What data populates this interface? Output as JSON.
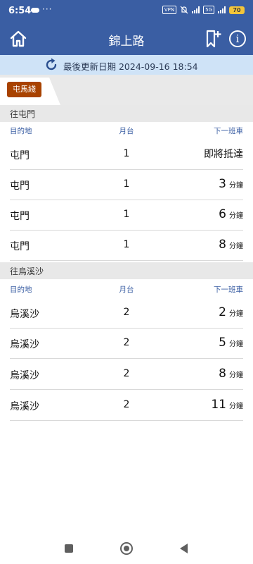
{
  "status_bar": {
    "time": "6:54",
    "overflow": "···",
    "vpn": "VPN",
    "battery": "70",
    "network": "5G"
  },
  "header": {
    "title": "錦上路",
    "home_icon": "home-icon",
    "bookmark_icon": "bookmark-add-icon",
    "info_label": "i"
  },
  "refresh": {
    "text": "最後更新日期 2024-09-16 18:54"
  },
  "tabs": [
    {
      "label": "屯馬綫",
      "color": "#a84200"
    }
  ],
  "columns": {
    "destination": "目的地",
    "platform": "月台",
    "next": "下一班車"
  },
  "sections": [
    {
      "title": "往屯門",
      "rows": [
        {
          "destination": "屯門",
          "platform": "1",
          "next_text": "即將抵達"
        },
        {
          "destination": "屯門",
          "platform": "1",
          "minutes": "3",
          "unit": "分鐘"
        },
        {
          "destination": "屯門",
          "platform": "1",
          "minutes": "6",
          "unit": "分鐘"
        },
        {
          "destination": "屯門",
          "platform": "1",
          "minutes": "8",
          "unit": "分鐘"
        }
      ]
    },
    {
      "title": "往烏溪沙",
      "rows": [
        {
          "destination": "烏溪沙",
          "platform": "2",
          "minutes": "2",
          "unit": "分鐘"
        },
        {
          "destination": "烏溪沙",
          "platform": "2",
          "minutes": "5",
          "unit": "分鐘"
        },
        {
          "destination": "烏溪沙",
          "platform": "2",
          "minutes": "8",
          "unit": "分鐘"
        },
        {
          "destination": "烏溪沙",
          "platform": "2",
          "minutes": "11",
          "unit": "分鐘"
        }
      ]
    }
  ],
  "colors": {
    "header": "#3a5ea3",
    "refresh_bar": "#cfe3f7",
    "line_badge": "#a84200"
  }
}
